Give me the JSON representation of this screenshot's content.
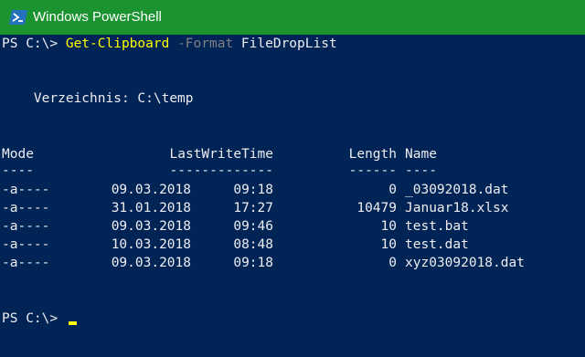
{
  "window": {
    "title": "Windows PowerShell"
  },
  "icon": "powershell-icon",
  "colors": {
    "titlebar": "#1b9330",
    "console_bg": "#012456",
    "text": "#eeedf0",
    "command": "#ffff00",
    "parameter": "#808080",
    "cursor": "#ffff00"
  },
  "console": {
    "prompt1": "PS C:\\> ",
    "command": "Get-Clipboard",
    "param_name": " -Format",
    "param_value": " FileDropList",
    "directory": "    Verzeichnis: C:\\temp",
    "headers": {
      "mode": "Mode",
      "lastwritetime": "LastWriteTime",
      "length": "Length",
      "name": "Name"
    },
    "underlines": {
      "mode": "----",
      "lastwritetime": "-------------",
      "length": "------",
      "name": "----"
    },
    "rows": [
      {
        "mode": "-a----",
        "date": "09.03.2018",
        "time": "09:18",
        "length": "0",
        "name": "_03092018.dat"
      },
      {
        "mode": "-a----",
        "date": "31.01.2018",
        "time": "17:27",
        "length": "10479",
        "name": "Januar18.xlsx"
      },
      {
        "mode": "-a----",
        "date": "09.03.2018",
        "time": "09:46",
        "length": "10",
        "name": "test.bat"
      },
      {
        "mode": "-a----",
        "date": "10.03.2018",
        "time": "08:48",
        "length": "10",
        "name": "test.dat"
      },
      {
        "mode": "-a----",
        "date": "09.03.2018",
        "time": "09:18",
        "length": "0",
        "name": "xyz03092018.dat"
      }
    ],
    "prompt2": "PS C:\\> "
  }
}
